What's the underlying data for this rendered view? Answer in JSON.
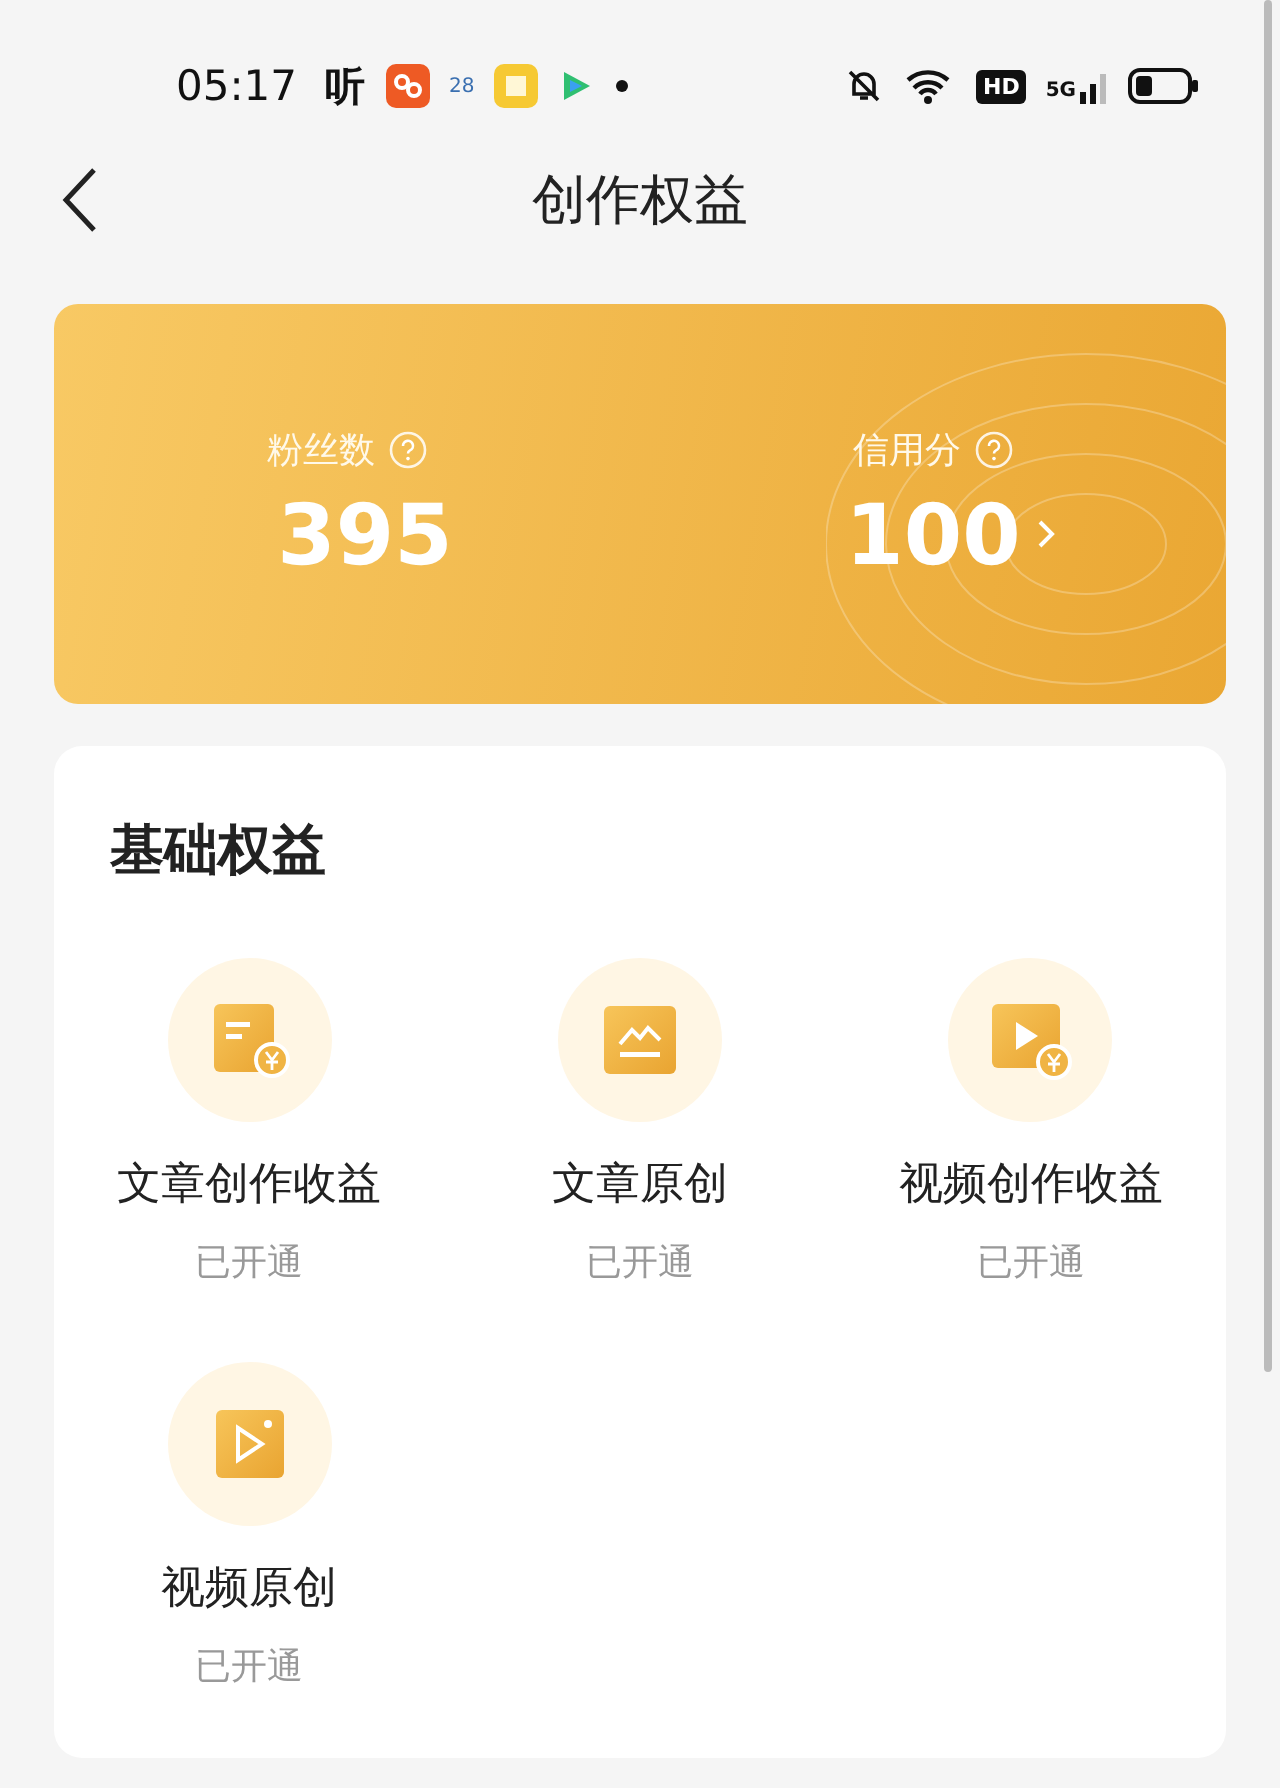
{
  "status_bar": {
    "time": "05:17",
    "app_glyph": "听",
    "calendar_day": "28",
    "hd": "HD",
    "network": "5G"
  },
  "header": {
    "title": "创作权益"
  },
  "stats": [
    {
      "label": "粉丝数",
      "value": "395",
      "link": false
    },
    {
      "label": "信用分",
      "value": "100",
      "link": true
    }
  ],
  "section": {
    "title": "基础权益",
    "items": [
      {
        "kind": "article-income",
        "name": "文章创作收益",
        "status": "已开通"
      },
      {
        "kind": "article-original",
        "name": "文章原创",
        "status": "已开通"
      },
      {
        "kind": "video-income",
        "name": "视频创作收益",
        "status": "已开通"
      },
      {
        "kind": "video-original",
        "name": "视频原创",
        "status": "已开通"
      }
    ]
  }
}
